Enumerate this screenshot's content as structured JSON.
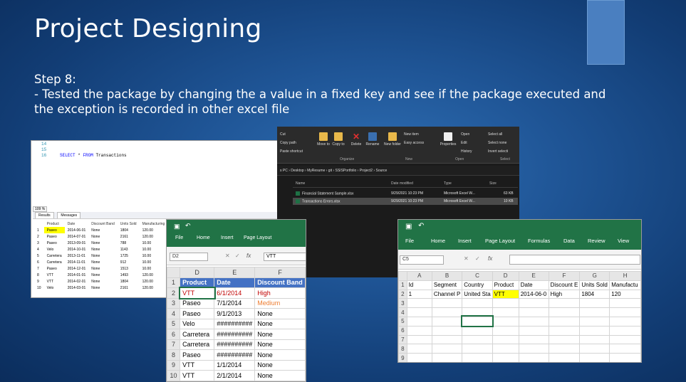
{
  "slide": {
    "title": "Project Designing",
    "step": "Step 8:",
    "bullet_line1": "- Tested the package by changing the a value in a fixed key and see if the package executed and",
    "bullet_line2": "the exception is recorded in other excel file"
  },
  "ssms": {
    "line_numbers": [
      "14",
      "15",
      "16"
    ],
    "query_keyword": "SELECT",
    "query_star": "*",
    "query_from": "FROM",
    "query_table": "Transactions",
    "zoom": "109 %",
    "tab_results": "Results",
    "tab_messages": "Messages",
    "columns": [
      "Product",
      "Date",
      "Discount Band",
      "Units Sold",
      "Manufacturing P"
    ],
    "rows": [
      [
        "1",
        "Paseo",
        "2014-06-01",
        "None",
        "1804",
        "120.00"
      ],
      [
        "2",
        "Paseo",
        "2014-07-01",
        "None",
        "2161",
        "120.00"
      ],
      [
        "3",
        "Paseo",
        "2013-09-01",
        "None",
        "788",
        "10.00"
      ],
      [
        "4",
        "Velo",
        "2014-10-01",
        "None",
        "1143",
        "10.00"
      ],
      [
        "5",
        "Carretera",
        "2013-11-01",
        "None",
        "1725",
        "10.00"
      ],
      [
        "6",
        "Carretera",
        "2014-11-01",
        "None",
        "912",
        "10.00"
      ],
      [
        "7",
        "Paseo",
        "2014-12-01",
        "None",
        "1513",
        "10.00"
      ],
      [
        "8",
        "VTT",
        "2014-01-01",
        "None",
        "1493",
        "120.00"
      ],
      [
        "9",
        "VTT",
        "2014-02-01",
        "None",
        "1804",
        "120.00"
      ],
      [
        "10",
        "Velo",
        "2014-03-01",
        "None",
        "2161",
        "120.00"
      ]
    ]
  },
  "explorer": {
    "cut": "Cut",
    "copy_path": "Copy path",
    "paste_shortcut": "Paste shortcut",
    "move_to": "Move to",
    "copy_to": "Copy to",
    "delete": "Delete",
    "rename": "Rename",
    "new_folder": "New folder",
    "new_item": "New item",
    "easy_access": "Easy access",
    "properties": "Properties",
    "open": "Open",
    "edit": "Edit",
    "history": "History",
    "select_all": "Select all",
    "select_none": "Select none",
    "invert_selection": "Invert selecti",
    "group_organize": "Organize",
    "group_new": "New",
    "group_open": "Open",
    "group_select": "Select",
    "breadcrumb": "s PC  ›  Desktop  ›  MyResume  ›  git  ›  SSISPortfolio  ›  Project2  ›  Source",
    "col_name": "Name",
    "col_date": "Date modified",
    "col_type": "Type",
    "col_size": "Size",
    "files": [
      {
        "name": "Financial Statement Sample.xlsx",
        "date": "9/29/2021 10:23 PM",
        "type": "Microsoft Excel W...",
        "size": "63 KB"
      },
      {
        "name": "Transactions Errors.xlsx",
        "date": "9/29/2021 10:23 PM",
        "type": "Microsoft Excel W...",
        "size": "10 KB"
      }
    ]
  },
  "excel1": {
    "menu": [
      "File",
      "Home",
      "Insert",
      "Page Layout"
    ],
    "namebox": "D2",
    "formula_fx": "fx",
    "formula_value": "VTT",
    "col_headers": [
      "D",
      "E",
      "F"
    ],
    "rows": [
      {
        "n": "1",
        "product": "Product",
        "date": "Date",
        "band": "Discount Band"
      },
      {
        "n": "2",
        "product": "VTT",
        "date": "6/1/2014",
        "band": "High"
      },
      {
        "n": "3",
        "product": "Paseo",
        "date": "7/1/2014",
        "band": "Medium"
      },
      {
        "n": "4",
        "product": "Paseo",
        "date": "9/1/2013",
        "band": "None"
      },
      {
        "n": "5",
        "product": "Velo",
        "date": "##########",
        "band": "None"
      },
      {
        "n": "6",
        "product": "Carretera",
        "date": "##########",
        "band": "None"
      },
      {
        "n": "7",
        "product": "Carretera",
        "date": "##########",
        "band": "None"
      },
      {
        "n": "8",
        "product": "Paseo",
        "date": "##########",
        "band": "None"
      },
      {
        "n": "9",
        "product": "VTT",
        "date": "1/1/2014",
        "band": "None"
      },
      {
        "n": "10",
        "product": "VTT",
        "date": "2/1/2014",
        "band": "None"
      }
    ]
  },
  "excel2": {
    "menu": [
      "File",
      "Home",
      "Insert",
      "Page Layout",
      "Formulas",
      "Data",
      "Review",
      "View"
    ],
    "namebox": "C5",
    "formula_fx": "fx",
    "col_headers": [
      "A",
      "B",
      "C",
      "D",
      "E",
      "F",
      "G",
      "H"
    ],
    "header_row": [
      "Id",
      "Segment",
      "Country",
      "Product",
      "Date",
      "Discount E",
      "Units Sold",
      "Manufactu"
    ],
    "data_row": [
      "1",
      "Channel P",
      "United Sta",
      "VTT",
      "2014-06-0",
      "High",
      "1804",
      "120"
    ],
    "row_numbers": [
      "1",
      "2",
      "3",
      "4",
      "5",
      "6",
      "7",
      "8",
      "9"
    ]
  },
  "colors": {
    "excel_green": "#217346",
    "header_blue": "#4472c4",
    "highlight_yellow": "#ffff00",
    "error_red": "#c00000",
    "medium_orange": "#ed7d31"
  }
}
